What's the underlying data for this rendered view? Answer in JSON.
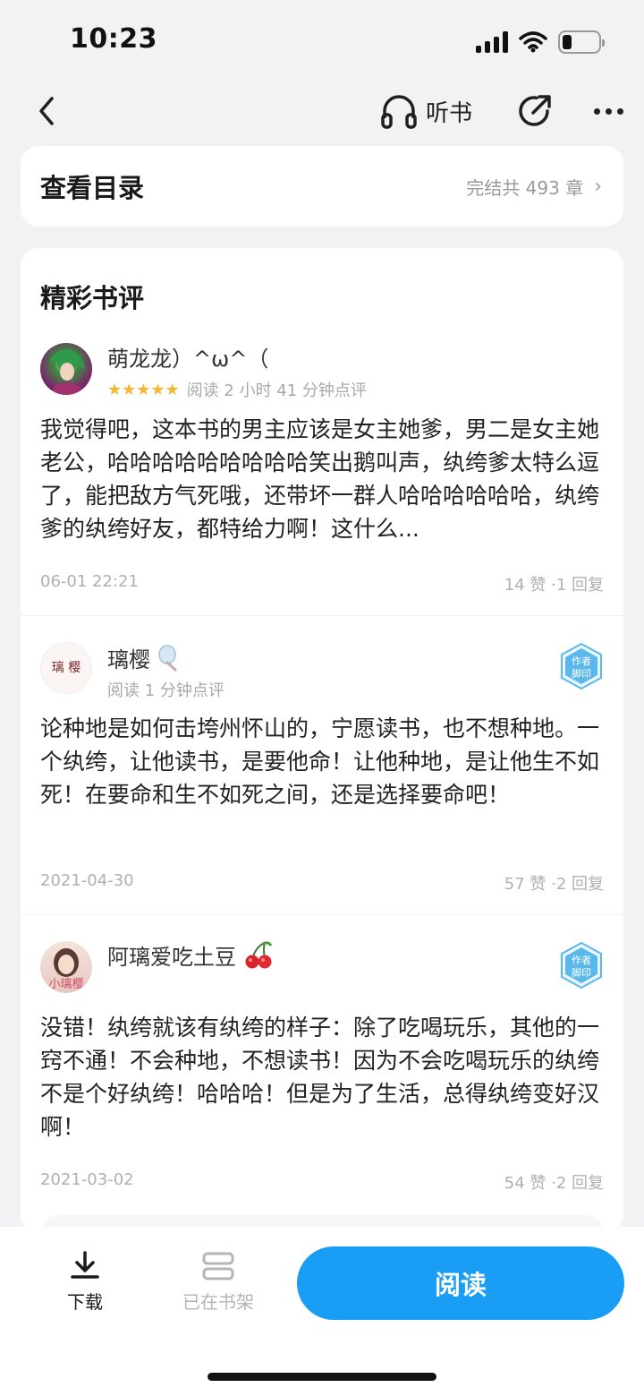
{
  "status_bar": {
    "time": "10:23",
    "battery_level": 0.25
  },
  "nav": {
    "listen_label": "听书",
    "icons": [
      "chevron-left-icon",
      "headphones-icon",
      "share-icon",
      "more-icon"
    ]
  },
  "toc": {
    "title": "查看目录",
    "status": "完结共 493 章",
    "chevron": "›"
  },
  "reviews": {
    "heading": "精彩书评",
    "items": [
      {
        "username": "萌龙龙）^ω^（",
        "stars": 5,
        "star_glyphs": "★★★★★",
        "meta": "阅读 2 小时 41 分钟点评",
        "text": "我觉得吧，这本书的男主应该是女主她爹，男二是女主她老公，哈哈哈哈哈哈哈哈哈笑出鹅叫声，纨绔爹太特么逗了，能把敌方气死哦，还带坏一群人哈哈哈哈哈哈，纨绔爹的纨绔好友，都特给力啊！这什么...",
        "date": "06-01 22:21",
        "stats": "14 赞 ·1 回复",
        "author_badge": false
      },
      {
        "username": "璃樱",
        "avatar_text": "璃 樱",
        "meta": "阅读 1 分钟点评",
        "text": "论种地是如何击垮州怀山的，宁愿读书，也不想种地。一个纨绔，让他读书，是要他命！让他种地，是让他生不如死！在要命和生不如死之间，还是选择要命吧！",
        "date": "2021-04-30",
        "stats": "57 赞 ·2 回复",
        "author_badge": true,
        "badge_text": [
          "作者",
          "脚印"
        ]
      },
      {
        "username": "阿璃爱吃土豆",
        "avatar_text": "小璃樱",
        "meta": "",
        "text": "没错！纨绔就该有纨绔的样子：除了吃喝玩乐，其他的一窍不通！不会种地，不想读书！因为不会吃喝玩乐的纨绔不是个好纨绔！哈哈哈！但是为了生活，总得纨绔变好汉啊！",
        "date": "2021-03-02",
        "stats": "54 赞 ·2 回复",
        "author_badge": true,
        "badge_text": [
          "作者",
          "脚印"
        ]
      }
    ]
  },
  "bottom_bar": {
    "download_label": "下载",
    "shelf_label": "已在书架",
    "read_label": "阅读"
  },
  "colors": {
    "accent": "#1a9ef5",
    "star": "#f7b731",
    "badge": "#5bb8ea"
  }
}
